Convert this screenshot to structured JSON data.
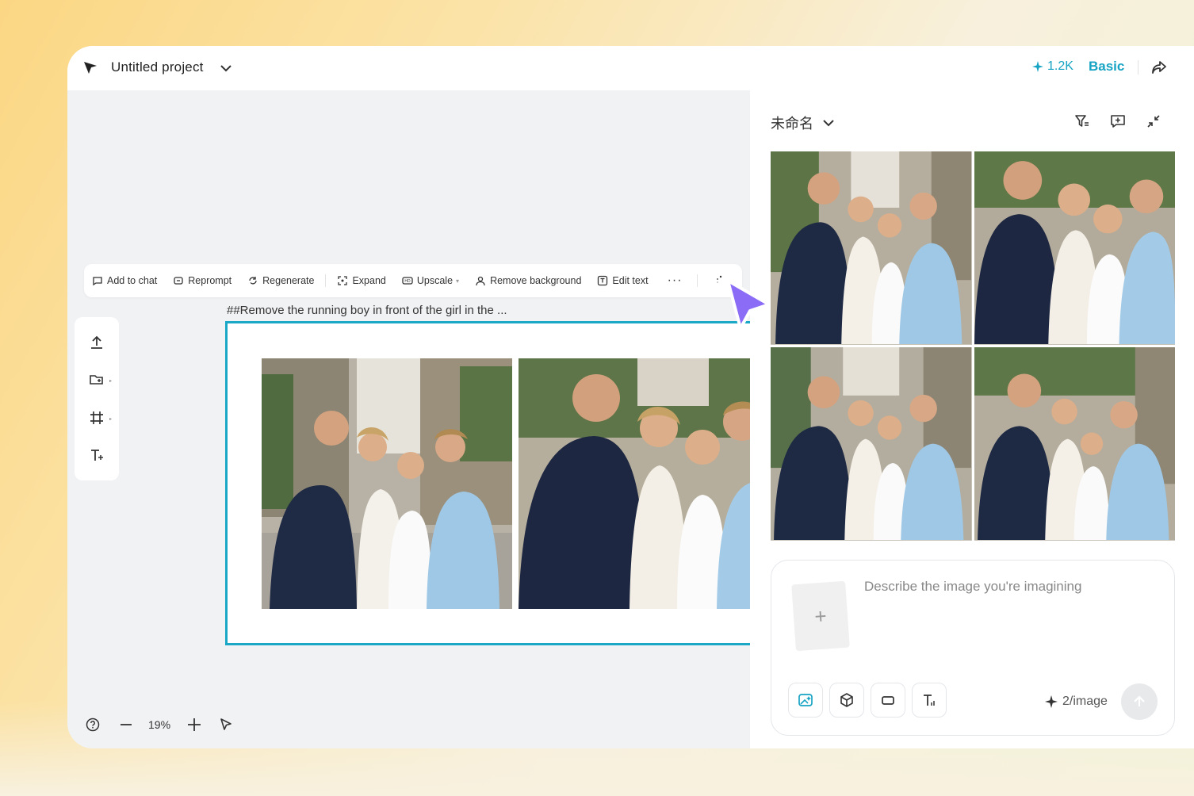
{
  "header": {
    "project_title": "Untitled project",
    "credits": "1.2K",
    "plan": "Basic"
  },
  "toolbar": {
    "add_to_chat": "Add to chat",
    "reprompt": "Reprompt",
    "regenerate": "Regenerate",
    "expand": "Expand",
    "upscale": "Upscale",
    "remove_background": "Remove background",
    "edit_text": "Edit text",
    "more": "···"
  },
  "canvas": {
    "prompt_label": "##Remove the running boy in front of the girl in the ...",
    "zoom": "19%"
  },
  "panel": {
    "title": "未命名",
    "placeholder": "Describe the image you're imagining",
    "cost": "2/image"
  },
  "colors": {
    "accent": "#1aa8c6",
    "cursor": "#8b6cf6"
  }
}
